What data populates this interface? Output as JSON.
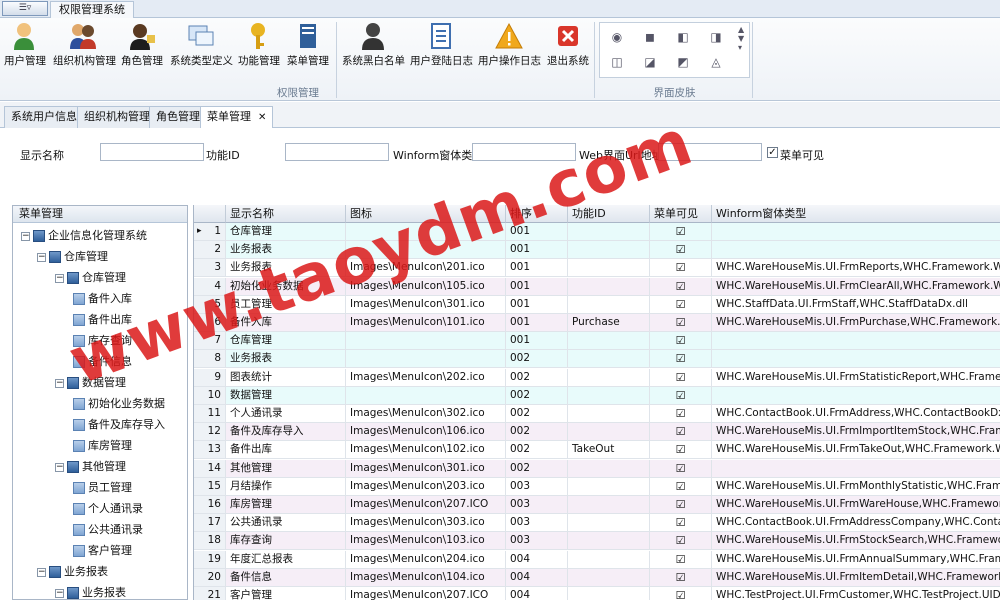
{
  "app_tab": "权限管理系统",
  "app_button_glyph": "☰▿",
  "ribbon": {
    "buttons": [
      {
        "label": "用户管理",
        "icon": "user-icon"
      },
      {
        "label": "组织机构管理",
        "icon": "organization-icon"
      },
      {
        "label": "角色管理",
        "icon": "role-icon"
      },
      {
        "label": "系统类型定义",
        "icon": "system-type-icon"
      },
      {
        "label": "功能管理",
        "icon": "key-icon"
      },
      {
        "label": "菜单管理",
        "icon": "menu-book-icon"
      },
      {
        "label": "系统黑白名单",
        "icon": "blacklist-icon"
      },
      {
        "label": "用户登陆日志",
        "icon": "login-log-icon"
      },
      {
        "label": "用户操作日志",
        "icon": "warning-log-icon"
      },
      {
        "label": "退出系统",
        "icon": "exit-icon"
      }
    ],
    "group_permissions": "权限管理",
    "group_skins": "界面皮肤",
    "skins": [
      "◉",
      "◼",
      "◧",
      "◨",
      "◫",
      "◪",
      "◩",
      "◬"
    ]
  },
  "tabs": [
    {
      "label": "系统用户信息"
    },
    {
      "label": "组织机构管理"
    },
    {
      "label": "角色管理"
    },
    {
      "label": "菜单管理",
      "close": "✕"
    }
  ],
  "filter": {
    "display_name_label": "显示名称",
    "function_id_label": "功能ID",
    "winform_label": "Winform窗体类型",
    "url_label": "Web界面Url地址",
    "visible_label": "菜单可见",
    "visible_checked": "✓"
  },
  "tree": {
    "header": "菜单管理",
    "nodes": [
      {
        "label": "企业信息化管理系统",
        "exp": "−",
        "leaf": false
      },
      {
        "label": "仓库管理",
        "exp": "−",
        "leaf": false
      },
      {
        "label": "仓库管理",
        "exp": "−",
        "leaf": false
      },
      {
        "label": "备件入库",
        "exp": "",
        "leaf": true
      },
      {
        "label": "备件出库",
        "exp": "",
        "leaf": true
      },
      {
        "label": "库存查询",
        "exp": "",
        "leaf": true
      },
      {
        "label": "备件信息",
        "exp": "",
        "leaf": true
      },
      {
        "label": "数据管理",
        "exp": "−",
        "leaf": false
      },
      {
        "label": "初始化业务数据",
        "exp": "",
        "leaf": true
      },
      {
        "label": "备件及库存导入",
        "exp": "",
        "leaf": true
      },
      {
        "label": "库房管理",
        "exp": "",
        "leaf": true
      },
      {
        "label": "其他管理",
        "exp": "−",
        "leaf": false
      },
      {
        "label": "员工管理",
        "exp": "",
        "leaf": true
      },
      {
        "label": "个人通讯录",
        "exp": "",
        "leaf": true
      },
      {
        "label": "公共通讯录",
        "exp": "",
        "leaf": true
      },
      {
        "label": "客户管理",
        "exp": "",
        "leaf": true
      },
      {
        "label": "业务报表",
        "exp": "−",
        "leaf": false
      },
      {
        "label": "业务报表",
        "exp": "−",
        "leaf": false
      }
    ]
  },
  "grid": {
    "columns": [
      "显示名称",
      "图标",
      "排序",
      "功能ID",
      "菜单可见",
      "Winform窗体类型"
    ],
    "row_indicator": "▸",
    "rows": [
      {
        "n": "1",
        "name": "仓库管理",
        "icon": "",
        "sort": "001",
        "fid": "",
        "vis": "☑",
        "winform": ""
      },
      {
        "n": "2",
        "name": "业务报表",
        "icon": "",
        "sort": "001",
        "fid": "",
        "vis": "☑",
        "winform": ""
      },
      {
        "n": "3",
        "name": "业务报表",
        "icon": "Images\\MenuIcon\\201.ico",
        "sort": "001",
        "fid": "",
        "vis": "☑",
        "winform": "WHC.WareHouseMis.UI.FrmReports,WHC.Framework.WareHouseM"
      },
      {
        "n": "4",
        "name": "初始化业务数据",
        "icon": "Images\\MenuIcon\\105.ico",
        "sort": "001",
        "fid": "",
        "vis": "☑",
        "winform": "WHC.WareHouseMis.UI.FrmClearAll,WHC.Framework.WareHouseD"
      },
      {
        "n": "5",
        "name": "员工管理",
        "icon": "Images\\MenuIcon\\301.ico",
        "sort": "001",
        "fid": "",
        "vis": "☑",
        "winform": "WHC.StaffData.UI.FrmStaff,WHC.StaffDataDx.dll"
      },
      {
        "n": "6",
        "name": "备件入库",
        "icon": "Images\\MenuIcon\\101.ico",
        "sort": "001",
        "fid": "Purchase",
        "vis": "☑",
        "winform": "WHC.WareHouseMis.UI.FrmPurchase,WHC.Framework.WareHous"
      },
      {
        "n": "7",
        "name": "仓库管理",
        "icon": "",
        "sort": "001",
        "fid": "",
        "vis": "☑",
        "winform": ""
      },
      {
        "n": "8",
        "name": "业务报表",
        "icon": "",
        "sort": "002",
        "fid": "",
        "vis": "☑",
        "winform": ""
      },
      {
        "n": "9",
        "name": "图表统计",
        "icon": "Images\\MenuIcon\\202.ico",
        "sort": "002",
        "fid": "",
        "vis": "☑",
        "winform": "WHC.WareHouseMis.UI.FrmStatisticReport,WHC.Framework.Ware"
      },
      {
        "n": "10",
        "name": "数据管理",
        "icon": "",
        "sort": "002",
        "fid": "",
        "vis": "☑",
        "winform": ""
      },
      {
        "n": "11",
        "name": "个人通讯录",
        "icon": "Images\\MenuIcon\\302.ico",
        "sort": "002",
        "fid": "",
        "vis": "☑",
        "winform": "WHC.ContactBook.UI.FrmAddress,WHC.ContactBookDx.dll"
      },
      {
        "n": "12",
        "name": "备件及库存导入",
        "icon": "Images\\MenuIcon\\106.ico",
        "sort": "002",
        "fid": "",
        "vis": "☑",
        "winform": "WHC.WareHouseMis.UI.FrmImportItemStock,WHC.Framework.W"
      },
      {
        "n": "13",
        "name": "备件出库",
        "icon": "Images\\MenuIcon\\102.ico",
        "sort": "002",
        "fid": "TakeOut",
        "vis": "☑",
        "winform": "WHC.WareHouseMis.UI.FrmTakeOut,WHC.Framework.WareHouse"
      },
      {
        "n": "14",
        "name": "其他管理",
        "icon": "Images\\MenuIcon\\301.ico",
        "sort": "002",
        "fid": "",
        "vis": "☑",
        "winform": ""
      },
      {
        "n": "15",
        "name": "月结操作",
        "icon": "Images\\MenuIcon\\203.ico",
        "sort": "003",
        "fid": "",
        "vis": "☑",
        "winform": "WHC.WareHouseMis.UI.FrmMonthlyStatistic,WHC.Framework.War"
      },
      {
        "n": "16",
        "name": "库房管理",
        "icon": "Images\\MenuIcon\\207.ICO",
        "sort": "003",
        "fid": "",
        "vis": "☑",
        "winform": "WHC.WareHouseMis.UI.FrmWareHouse,WHC.Framework.WareH"
      },
      {
        "n": "17",
        "name": "公共通讯录",
        "icon": "Images\\MenuIcon\\303.ico",
        "sort": "003",
        "fid": "",
        "vis": "☑",
        "winform": "WHC.ContactBook.UI.FrmAddressCompany,WHC.ContactBookDx."
      },
      {
        "n": "18",
        "name": "库存查询",
        "icon": "Images\\MenuIcon\\103.ico",
        "sort": "003",
        "fid": "",
        "vis": "☑",
        "winform": "WHC.WareHouseMis.UI.FrmStockSearch,WHC.Framework.WareH"
      },
      {
        "n": "19",
        "name": "年度汇总报表",
        "icon": "Images\\MenuIcon\\204.ico",
        "sort": "004",
        "fid": "",
        "vis": "☑",
        "winform": "WHC.WareHouseMis.UI.FrmAnnualSummary,WHC.Framework.Wa"
      },
      {
        "n": "20",
        "name": "备件信息",
        "icon": "Images\\MenuIcon\\104.ico",
        "sort": "004",
        "fid": "",
        "vis": "☑",
        "winform": "WHC.WareHouseMis.UI.FrmItemDetail,WHC.Framework.WareHo"
      },
      {
        "n": "21",
        "name": "客户管理",
        "icon": "Images\\MenuIcon\\207.ICO",
        "sort": "004",
        "fid": "",
        "vis": "☑",
        "winform": "WHC.TestProject.UI.FrmCustomer,WHC.TestProject.UIDX.dll"
      }
    ]
  },
  "watermark": "www.taoydm.com",
  "colors": {
    "row_alt": "#e8fbfb",
    "row_base": "#ffffff",
    "row_pink": "#f6eef7",
    "watermark": "#da1919",
    "accent": "#2f5f9a"
  }
}
